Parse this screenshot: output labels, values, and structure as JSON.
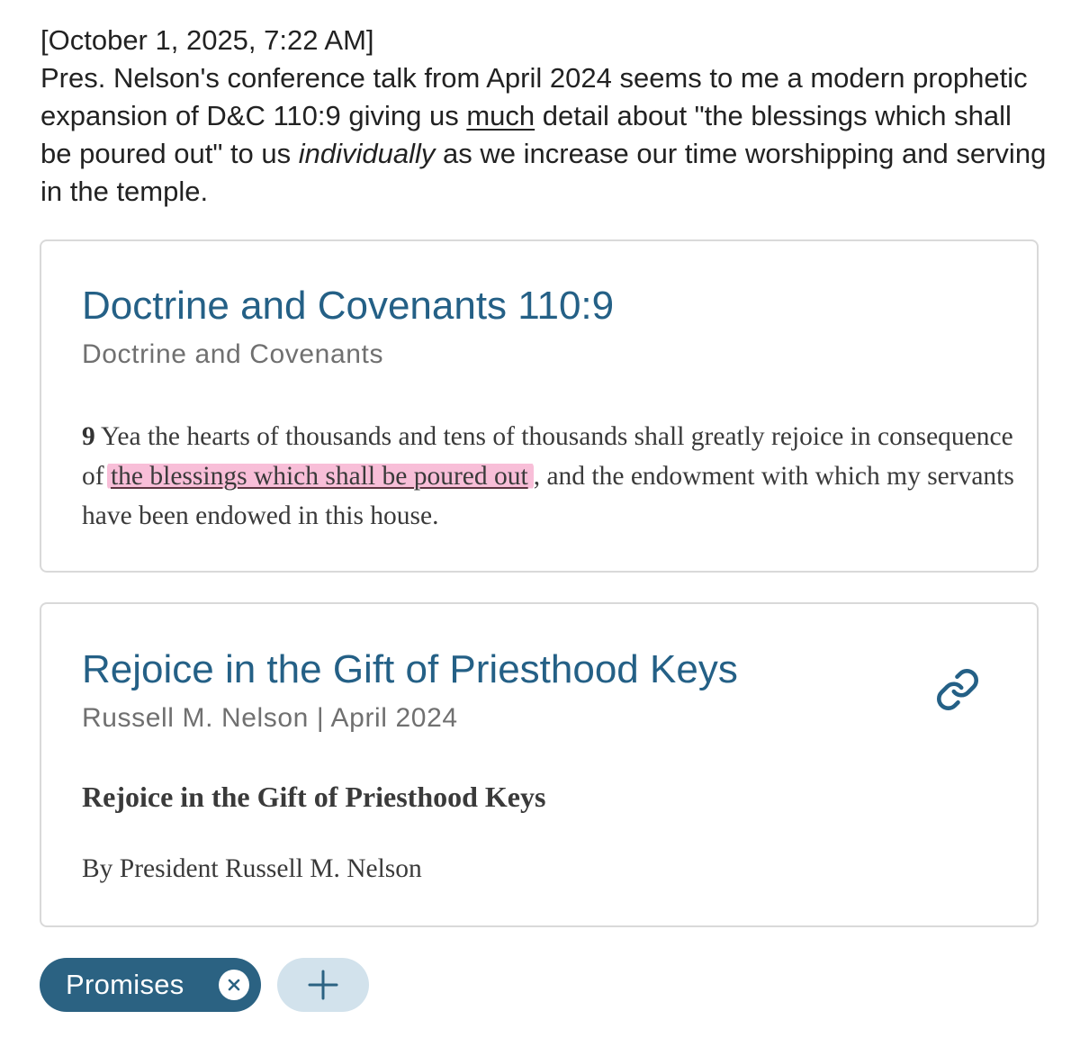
{
  "note": {
    "timestamp": "[October 1, 2025, 7:22 AM]",
    "text_part1": "Pres. Nelson's conference talk from April 2024 seems to me a modern prophetic expansion of D&C 110:9 giving us ",
    "text_underlined": "much",
    "text_part2": " detail about \"the blessings which shall be poured out\" to us ",
    "text_italic": "individually",
    "text_part3": " as we increase our time worshipping and serving in the temple."
  },
  "scripture_card": {
    "title": "Doctrine and Covenants 110:9",
    "subtitle": "Doctrine and Covenants",
    "verse_number": "9",
    "verse_before": " Yea the hearts of thousands and tens of thousands shall greatly rejoice in consequence of ",
    "verse_highlight": "the blessings which shall be poured out",
    "verse_after": ", and the endowment with which my servants have been endowed in this house.",
    "highlight_color": "#f6a9cb"
  },
  "talk_card": {
    "title": "Rejoice in the Gift of Priesthood Keys",
    "subtitle": "Russell M. Nelson | April 2024",
    "heading": "Rejoice in the Gift of Priesthood Keys",
    "byline": "By President Russell M. Nelson",
    "link_icon": "link-icon"
  },
  "tags": {
    "items": [
      {
        "label": "Promises",
        "remove_icon": "close-icon"
      }
    ],
    "add_icon": "plus-icon",
    "accent_color": "#2b6282"
  }
}
